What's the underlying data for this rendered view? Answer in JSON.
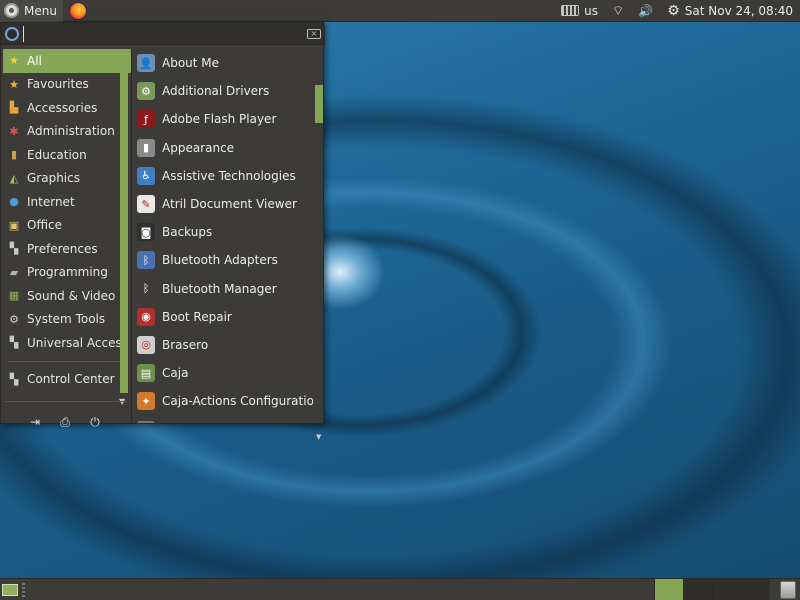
{
  "top_panel": {
    "menu_label": "Menu",
    "keyboard_layout": "us",
    "clock": "Sat Nov 24, 08:40"
  },
  "search": {
    "value": "",
    "placeholder": ""
  },
  "categories": [
    {
      "label": "All",
      "icon": "star-icon",
      "color": "#f5d23a",
      "active": true
    },
    {
      "label": "Favourites",
      "icon": "star-icon",
      "color": "#f5b02a"
    },
    {
      "label": "Accessories",
      "icon": "accessories-icon",
      "color": "#e8a33a"
    },
    {
      "label": "Administration",
      "icon": "administration-icon",
      "color": "#d9534f"
    },
    {
      "label": "Education",
      "icon": "education-icon",
      "color": "#caa04a"
    },
    {
      "label": "Graphics",
      "icon": "graphics-icon",
      "color": "#9fc05a"
    },
    {
      "label": "Internet",
      "icon": "globe-icon",
      "color": "#4e9bd6"
    },
    {
      "label": "Office",
      "icon": "office-icon",
      "color": "#e0c36b"
    },
    {
      "label": "Preferences",
      "icon": "preferences-icon",
      "color": "#c9c9c9"
    },
    {
      "label": "Programming",
      "icon": "programming-icon",
      "color": "#b0b0b0"
    },
    {
      "label": "Sound & Video",
      "icon": "sound-video-icon",
      "color": "#8fb060"
    },
    {
      "label": "System Tools",
      "icon": "gear-icon",
      "color": "#d0d0d0"
    },
    {
      "label": "Universal Access",
      "icon": "universal-access-icon",
      "color": "#c9c9c9"
    }
  ],
  "control_center": {
    "label": "Control Center",
    "icon": "control-center-icon",
    "color": "#c9c9c9"
  },
  "apps": [
    {
      "label": "About Me",
      "icon": "about-me-icon",
      "color": "#6f8fb0",
      "glyph": "👤"
    },
    {
      "label": "Additional Drivers",
      "icon": "additional-drivers-icon",
      "color": "#7a9a5a",
      "glyph": "⚙"
    },
    {
      "label": "Adobe Flash Player",
      "icon": "flash-player-icon",
      "color": "#8b1a1a",
      "glyph": "ƒ"
    },
    {
      "label": "Appearance",
      "icon": "appearance-icon",
      "color": "#8a8a8a",
      "glyph": "▮"
    },
    {
      "label": "Assistive Technologies",
      "icon": "assistive-technologies-icon",
      "color": "#3f7fc4",
      "glyph": "♿"
    },
    {
      "label": "Atril Document Viewer",
      "icon": "document-viewer-icon",
      "color": "#e8e8e8",
      "glyph": "✎"
    },
    {
      "label": "Backups",
      "icon": "backups-icon",
      "color": "#2f2f2f",
      "glyph": "◙"
    },
    {
      "label": "Bluetooth Adapters",
      "icon": "bluetooth-adapters-icon",
      "color": "#4a6fb0",
      "glyph": "ᛒ"
    },
    {
      "label": "Bluetooth Manager",
      "icon": "bluetooth-icon",
      "color": "#3c3b37",
      "glyph": "ᛒ"
    },
    {
      "label": "Boot Repair",
      "icon": "boot-repair-icon",
      "color": "#b03030",
      "glyph": "◉"
    },
    {
      "label": "Brasero",
      "icon": "brasero-icon",
      "color": "#cfcfcf",
      "glyph": "◎"
    },
    {
      "label": "Caja",
      "icon": "caja-icon",
      "color": "#6f8f4a",
      "glyph": "▤"
    },
    {
      "label": "Caja-Actions Configuration ...",
      "icon": "caja-actions-icon",
      "color": "#d07a2a",
      "glyph": "✦"
    },
    {
      "label": "",
      "icon": "partial-app-icon",
      "color": "#777777",
      "glyph": ""
    }
  ],
  "bottom_buttons": [
    {
      "name": "lock-screen-button",
      "icon": "lock-icon",
      "glyph": "⇥"
    },
    {
      "name": "logout-button",
      "icon": "logout-icon",
      "glyph": "⎙"
    },
    {
      "name": "shutdown-button",
      "icon": "power-icon",
      "glyph": "⏻"
    }
  ],
  "colors": {
    "accent": "#87a556",
    "panel": "#3c3b37"
  }
}
